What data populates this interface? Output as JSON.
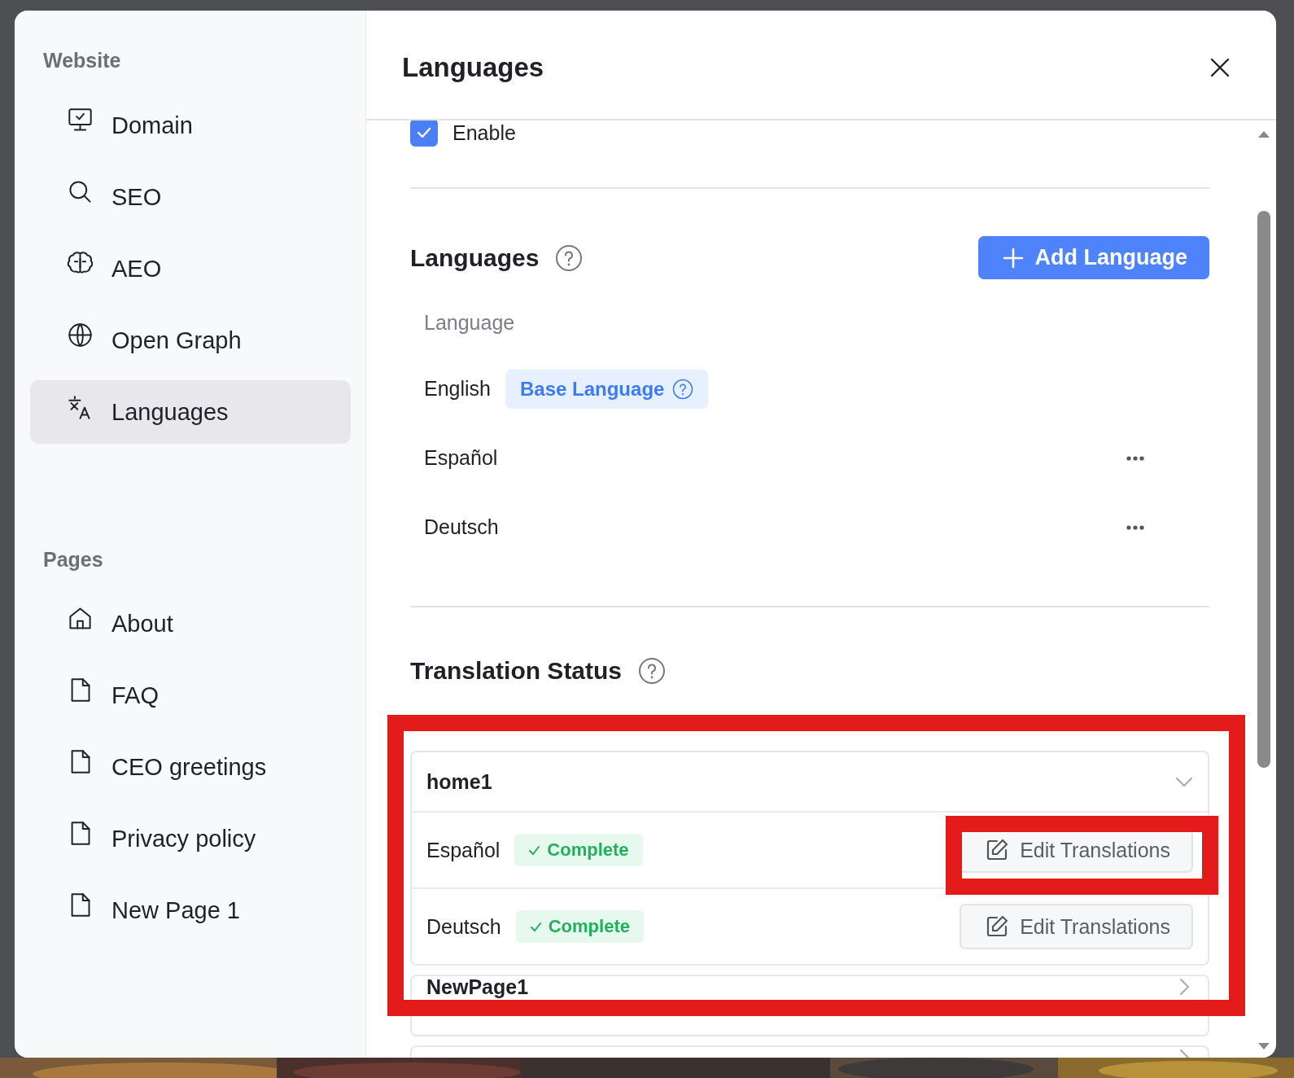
{
  "sidebar": {
    "sections": [
      {
        "title": "Website",
        "items": [
          {
            "label": "Domain",
            "selected": false
          },
          {
            "label": "SEO",
            "selected": false
          },
          {
            "label": "AEO",
            "selected": false
          },
          {
            "label": "Open Graph",
            "selected": false
          },
          {
            "label": "Languages",
            "selected": true
          }
        ]
      },
      {
        "title": "Pages",
        "items": [
          {
            "label": "About",
            "selected": false
          },
          {
            "label": "FAQ",
            "selected": false
          },
          {
            "label": "CEO greetings",
            "selected": false
          },
          {
            "label": "Privacy policy",
            "selected": false
          },
          {
            "label": "New Page 1",
            "selected": false
          }
        ]
      }
    ]
  },
  "panel": {
    "title": "Languages",
    "enable": {
      "label": "Enable",
      "checked": true
    },
    "languages": {
      "heading": "Languages",
      "add_button": "Add Language",
      "column": "Language",
      "rows": [
        {
          "name": "English",
          "base": true,
          "badge": "Base Language"
        },
        {
          "name": "Español",
          "base": false
        },
        {
          "name": "Deutsch",
          "base": false
        }
      ]
    },
    "translation_status": {
      "heading": "Translation Status",
      "highlighted": true,
      "pages": [
        {
          "name": "home1",
          "expanded": true,
          "languages": [
            {
              "name": "Español",
              "status": "Complete",
              "button": "Edit Translations",
              "highlighted": true
            },
            {
              "name": "Deutsch",
              "status": "Complete",
              "button": "Edit Translations",
              "highlighted": false
            }
          ]
        },
        {
          "name": "NewPage1",
          "expanded": false
        },
        {
          "expanded": false
        }
      ]
    }
  }
}
